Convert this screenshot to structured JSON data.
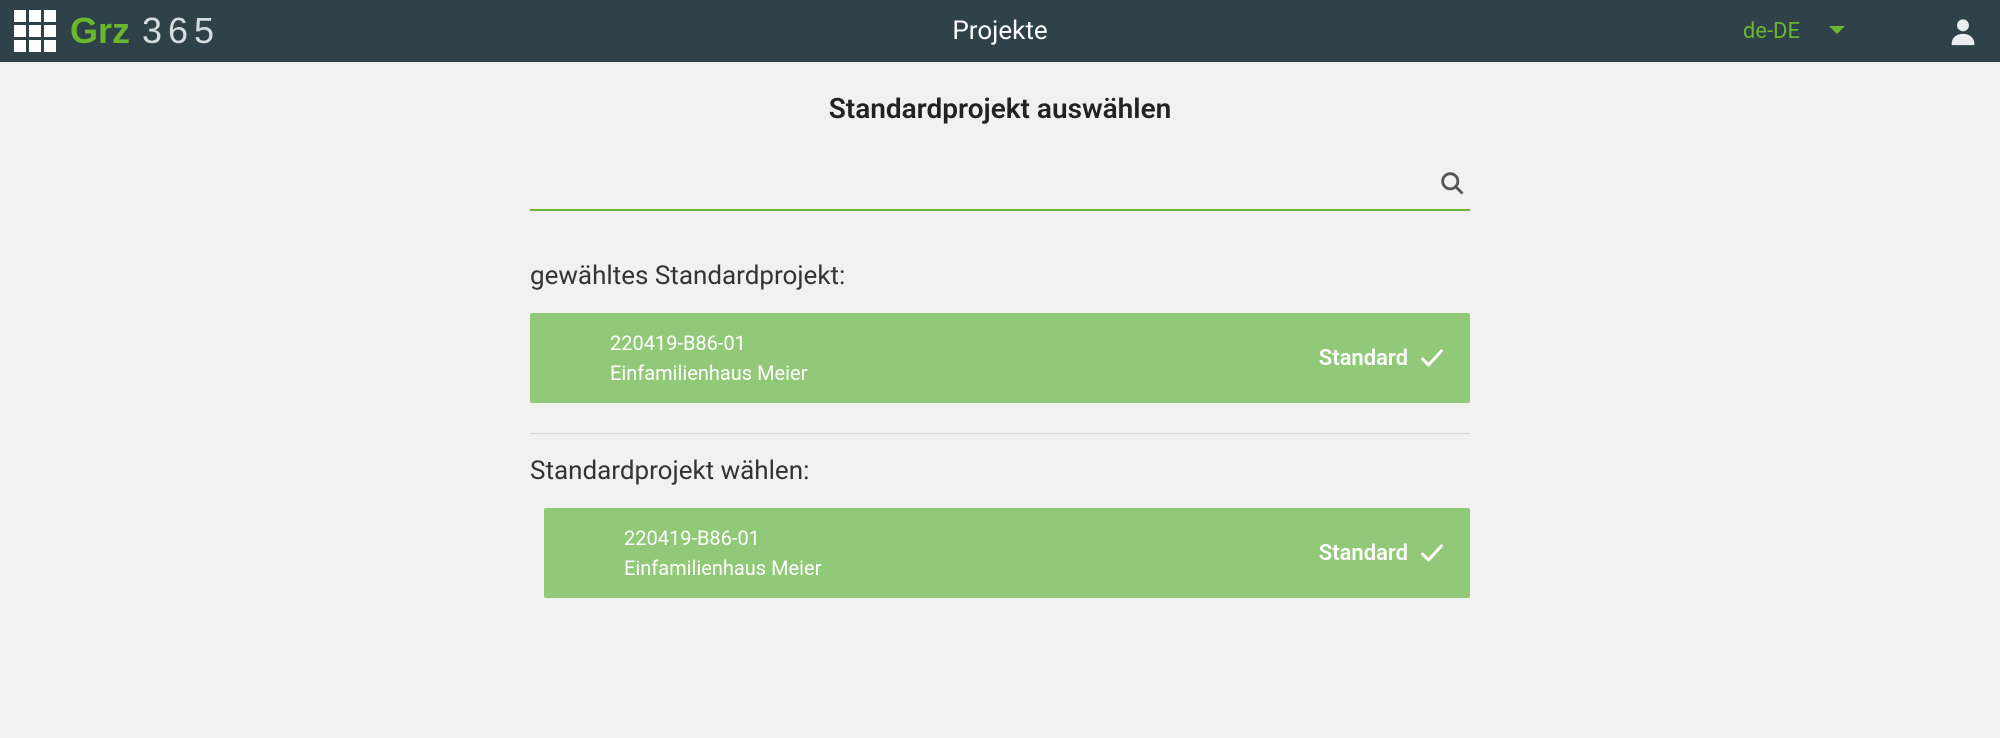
{
  "header": {
    "page_title": "Projekte",
    "language": "de-DE",
    "logo_grz": "Grz",
    "logo_365": "365"
  },
  "main": {
    "subtitle": "Standardprojekt auswählen",
    "search_placeholder": "",
    "selected_label": "gewähltes Standardprojekt:",
    "choose_label": "Standardprojekt wählen:",
    "selected_project": {
      "code": "220419-B86-01",
      "name": "Einfamilienhaus Meier",
      "standard_label": "Standard"
    },
    "projects": [
      {
        "code": "220419-B86-01",
        "name": "Einfamilienhaus Meier",
        "standard_label": "Standard"
      }
    ]
  }
}
